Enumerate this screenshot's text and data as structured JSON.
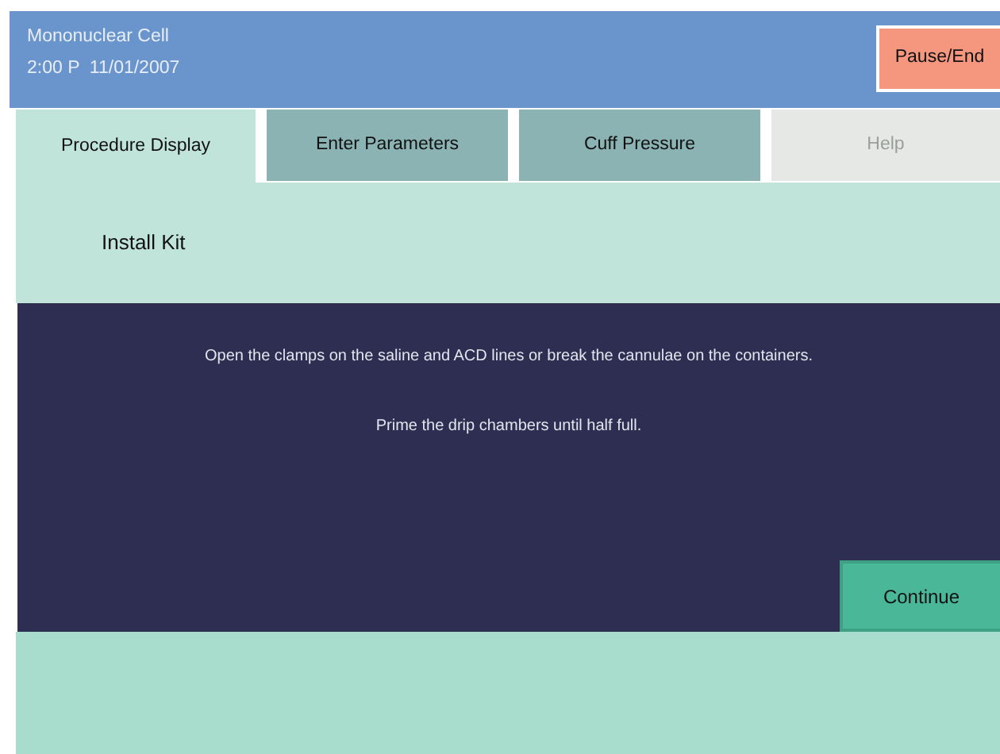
{
  "header": {
    "title": "Mononuclear Cell",
    "datetime": "2:00 P  11/01/2007",
    "action_button": "Pause/End"
  },
  "tabs": [
    {
      "label": "Procedure Display",
      "selected": true,
      "disabled": false
    },
    {
      "label": "Enter Parameters",
      "selected": false,
      "disabled": false
    },
    {
      "label": "Cuff Pressure",
      "selected": false,
      "disabled": false
    },
    {
      "label": "Help",
      "selected": false,
      "disabled": true
    }
  ],
  "step_title": "Install Kit",
  "instructions": [
    "Open the clamps on the saline and ACD lines or break the cannulae on the containers.",
    "Prime the drip chambers until half full."
  ],
  "continue_button": "Continue"
}
